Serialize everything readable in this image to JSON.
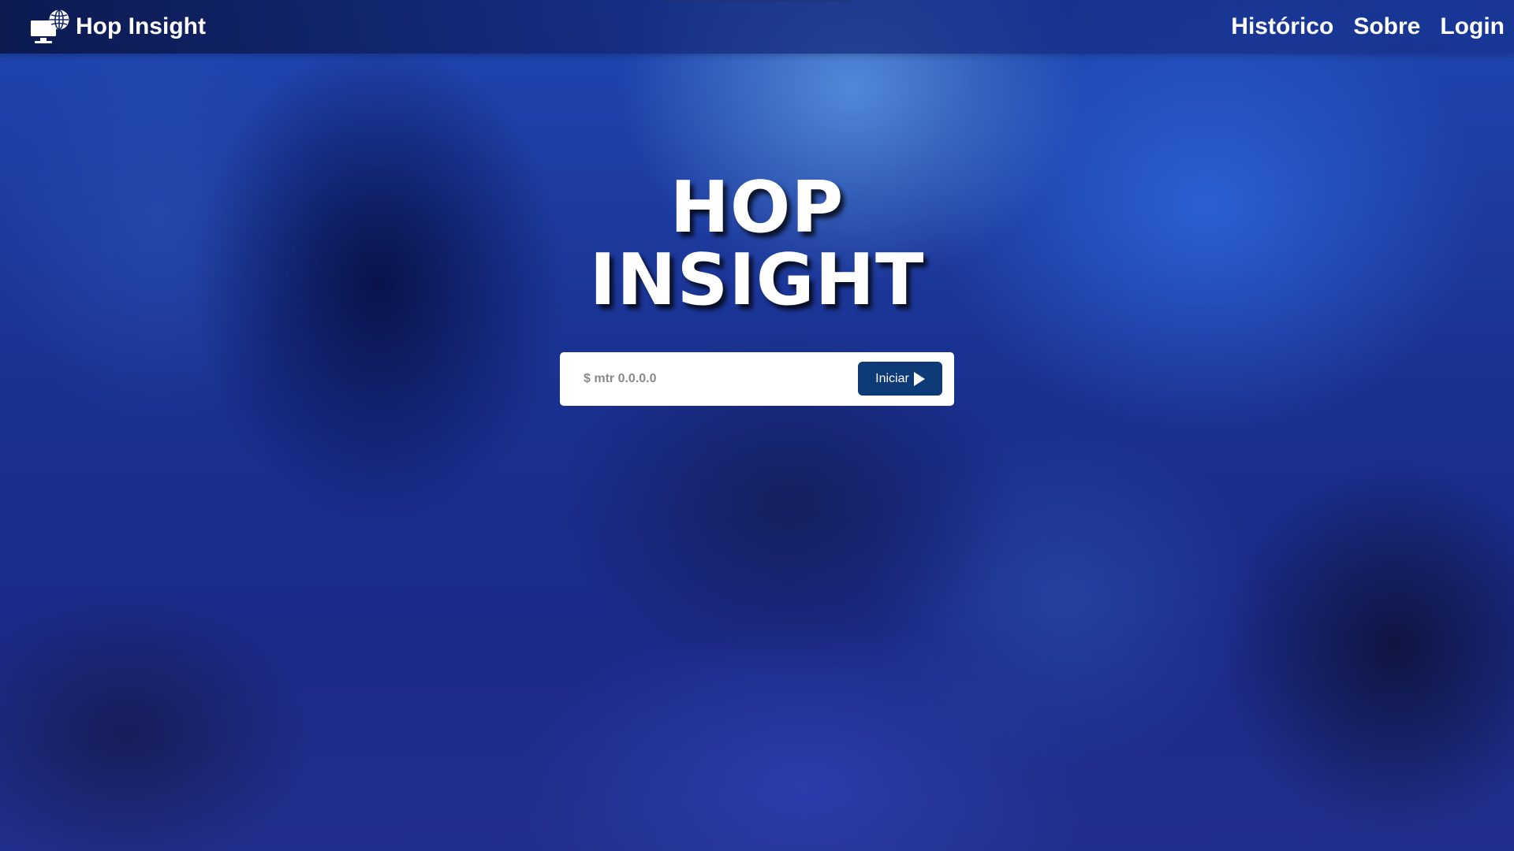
{
  "header": {
    "brand_name": "Hop Insight",
    "brand_icon": "monitor-globe-icon",
    "nav": [
      {
        "label": "Histórico"
      },
      {
        "label": "Sobre"
      },
      {
        "label": "Login"
      }
    ]
  },
  "hero": {
    "title_line1": "HOP",
    "title_line2": "INSIGHT"
  },
  "search": {
    "placeholder": "$ mtr 0.0.0.0",
    "value": "",
    "button_label": "Iniciar",
    "button_icon": "play-icon"
  },
  "colors": {
    "button_bg": "#0f3a78",
    "background_primary": "#1f47b2",
    "text_light": "#ffffff"
  }
}
